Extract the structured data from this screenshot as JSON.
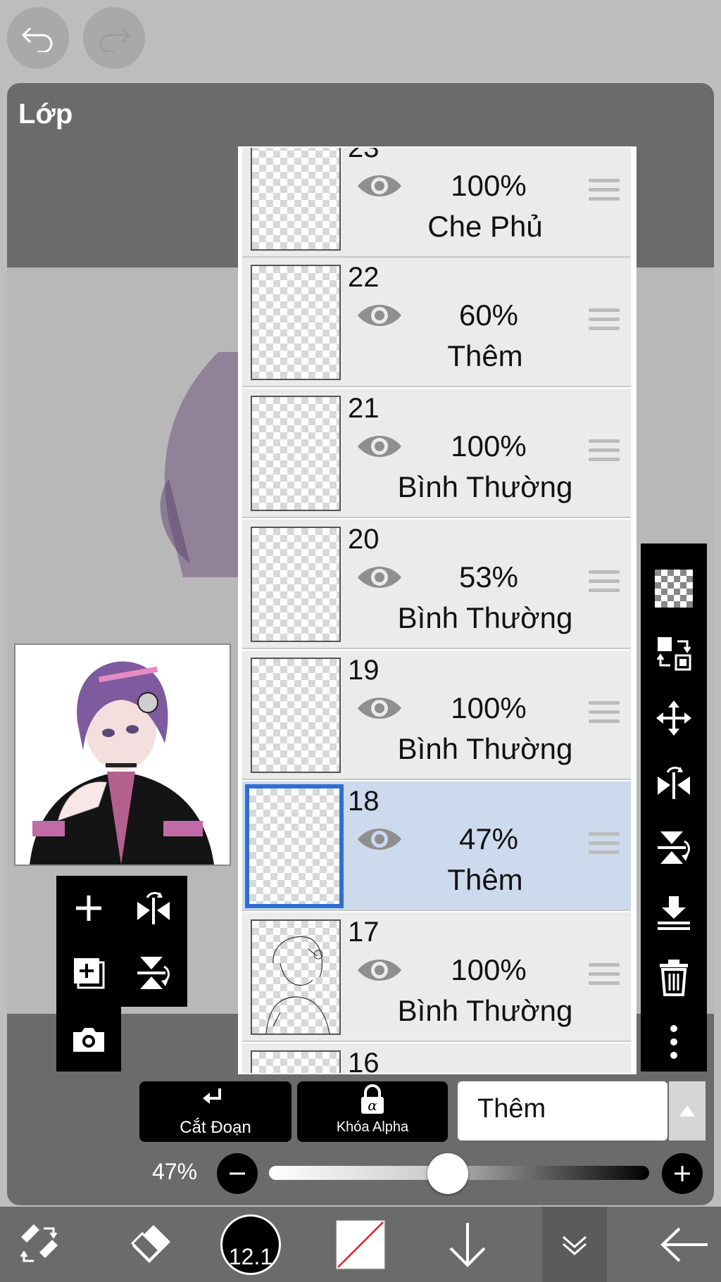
{
  "toolbar_top": {
    "undo_icon": "undo-icon",
    "redo_icon": "redo-icon"
  },
  "panel": {
    "title": "Lớp"
  },
  "layers": [
    {
      "number": "23",
      "opacity": "100%",
      "blend": "Che Phủ",
      "selected": false
    },
    {
      "number": "22",
      "opacity": "60%",
      "blend": "Thêm",
      "selected": false
    },
    {
      "number": "21",
      "opacity": "100%",
      "blend": "Bình Thường",
      "selected": false
    },
    {
      "number": "20",
      "opacity": "53%",
      "blend": "Bình Thường",
      "selected": false
    },
    {
      "number": "19",
      "opacity": "100%",
      "blend": "Bình Thường",
      "selected": false
    },
    {
      "number": "18",
      "opacity": "47%",
      "blend": "Thêm",
      "selected": true
    },
    {
      "number": "17",
      "opacity": "100%",
      "blend": "Bình Thường",
      "selected": false
    },
    {
      "number": "16",
      "opacity": "",
      "blend": "",
      "selected": false
    }
  ],
  "controls": {
    "clipping_label": "Cắt Đoạn",
    "alpha_lock_label": "Khóa Alpha",
    "blend_mode_value": "Thêm",
    "opacity_label": "47%",
    "opacity_value": 0.47
  },
  "bottom_bar": {
    "brush_size": "12.1"
  },
  "colors": {
    "selected_row": "#cdd9ec",
    "selected_border": "#2f6fcf",
    "panel": "#6b6b6b"
  }
}
